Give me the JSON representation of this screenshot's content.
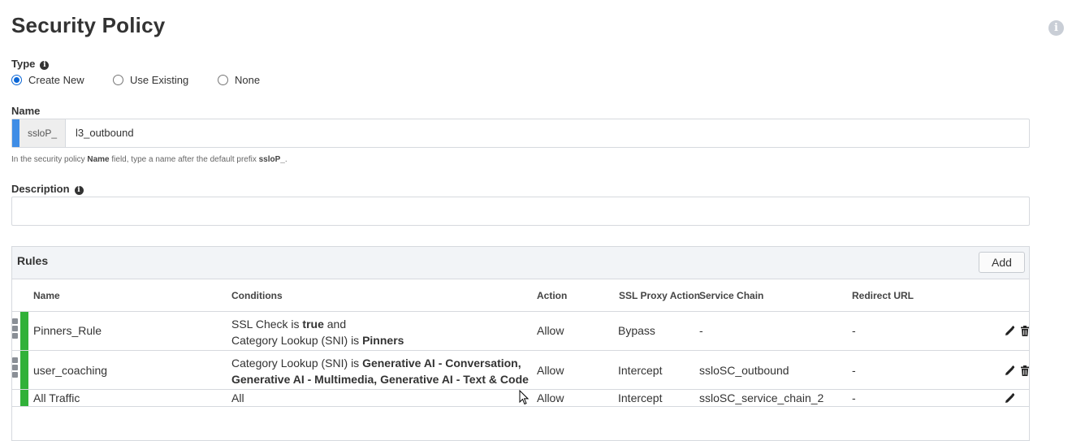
{
  "page": {
    "title": "Security Policy"
  },
  "type_field": {
    "label": "Type",
    "options": [
      {
        "label": "Create New",
        "selected": true
      },
      {
        "label": "Use Existing",
        "selected": false
      },
      {
        "label": "None",
        "selected": false
      }
    ]
  },
  "name_field": {
    "label": "Name",
    "prefix": "ssloP_",
    "value": "l3_outbound",
    "hint_1": "In the security policy ",
    "hint_bold_1": "Name",
    "hint_2": " field, type a name after the default prefix ",
    "hint_bold_2": "ssloP_",
    "hint_3": "."
  },
  "description_field": {
    "label": "Description",
    "value": ""
  },
  "rules": {
    "title": "Rules",
    "add_label": "Add",
    "columns": {
      "name": "Name",
      "conditions": "Conditions",
      "action": "Action",
      "ssl_proxy_action": "SSL Proxy Action",
      "service_chain": "Service Chain",
      "redirect_url": "Redirect URL"
    },
    "rows": [
      {
        "name": "Pinners_Rule",
        "cond_l1_a": "SSL Check  is  ",
        "cond_l1_b": "true",
        "cond_l1_c": "   and",
        "cond_l2_a": "Category Lookup (SNI)  is  ",
        "cond_l2_b": "Pinners",
        "action": "Allow",
        "ssl_proxy_action": "Bypass",
        "service_chain": "-",
        "redirect_url": "-",
        "status_color": "#31b139"
      },
      {
        "name": "user_coaching",
        "cond_l1_a": "Category Lookup (SNI)  is  ",
        "cond_l1_b": "Generative AI - Conversation,",
        "cond_l2_b": "Generative AI - Multimedia, Generative AI - Text & Code",
        "action": "Allow",
        "ssl_proxy_action": "Intercept",
        "service_chain": "ssloSC_outbound",
        "redirect_url": "-",
        "status_color": "#31b139"
      },
      {
        "name": "All Traffic",
        "conditions": "All",
        "action": "Allow",
        "ssl_proxy_action": "Intercept",
        "service_chain": "ssloSC_service_chain_2",
        "redirect_url": "-",
        "status_color": "#31b139"
      }
    ]
  },
  "colors": {
    "accent": "#3f8de6",
    "status_green": "#31b139",
    "radio_blue": "#0a66d6"
  },
  "icons": [
    "info-icon",
    "edit-icon",
    "delete-icon",
    "drag-handle-icon"
  ]
}
